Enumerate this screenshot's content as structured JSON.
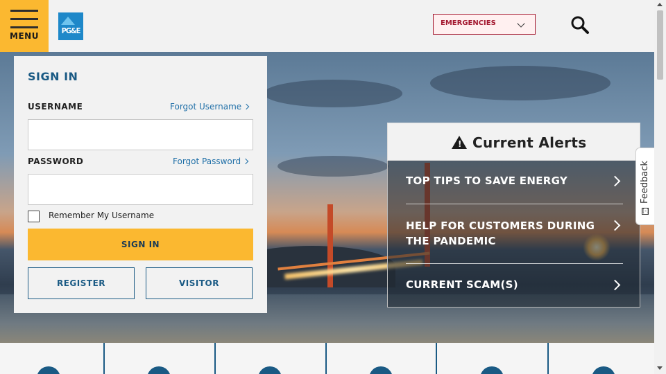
{
  "header": {
    "menu_label": "MENU",
    "logo_text": "PG&E",
    "emergencies_label": "EMERGENCIES"
  },
  "signin": {
    "title": "SIGN IN",
    "username_label": "USERNAME",
    "forgot_username": "Forgot Username",
    "password_label": "PASSWORD",
    "forgot_password": "Forgot Password",
    "username_value": "",
    "password_value": "",
    "remember_label": "Remember My Username",
    "remember_checked": false,
    "signin_button": "SIGN IN",
    "register_button": "REGISTER",
    "visitor_button": "VISITOR"
  },
  "alerts": {
    "title": "Current Alerts",
    "items": [
      {
        "label": "TOP TIPS TO SAVE ENERGY"
      },
      {
        "label": "HELP FOR CUSTOMERS DURING THE PANDEMIC"
      },
      {
        "label": "CURRENT SCAM(S)"
      }
    ]
  },
  "feedback": {
    "label": "Feedback",
    "icon": "[-]"
  },
  "colors": {
    "accent": "#fbb830",
    "brand_blue": "#1a5a84",
    "emergency_red": "#a3182f",
    "logo_blue": "#1e88c9"
  },
  "icons": {
    "menu": "hamburger-icon",
    "search": "search-icon",
    "emergencies": "chevron-down-icon",
    "alert": "warning-icon"
  }
}
